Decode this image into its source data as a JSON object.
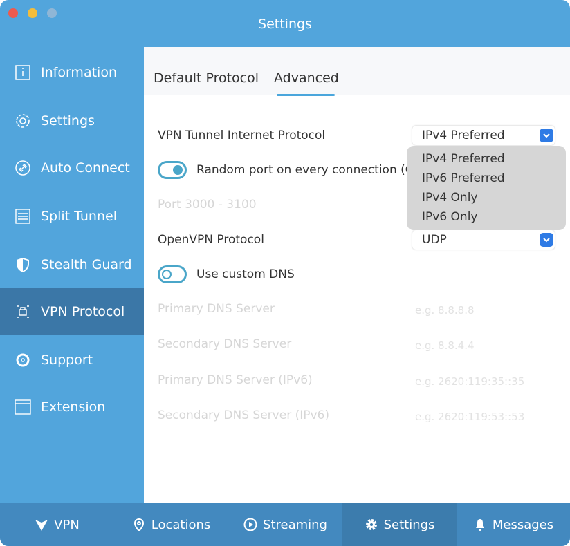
{
  "window": {
    "title": "Settings"
  },
  "sidebar": {
    "items": [
      {
        "label": "Information",
        "icon": "info-icon"
      },
      {
        "label": "Settings",
        "icon": "gear-icon"
      },
      {
        "label": "Auto Connect",
        "icon": "link-icon"
      },
      {
        "label": "Split Tunnel",
        "icon": "sliders-icon"
      },
      {
        "label": "Stealth Guard",
        "icon": "shield-icon"
      },
      {
        "label": "VPN Protocol",
        "icon": "network-icon",
        "selected": true
      },
      {
        "label": "Support",
        "icon": "lifebuoy-icon"
      },
      {
        "label": "Extension",
        "icon": "browser-window-icon"
      }
    ]
  },
  "tabs": [
    {
      "label": "Default Protocol"
    },
    {
      "label": "Advanced",
      "active": true
    }
  ],
  "form": {
    "tunnel_protocol": {
      "label": "VPN Tunnel Internet Protocol",
      "value": "IPv4 Preferred",
      "options": [
        "IPv4 Preferred",
        "IPv6 Preferred",
        "IPv4 Only",
        "IPv6 Only"
      ]
    },
    "random_port": {
      "label": "Random port on every connection (C",
      "enabled": true
    },
    "port_range": "Port 3000 - 3100",
    "openvpn_protocol": {
      "label": "OpenVPN Protocol",
      "value": "UDP"
    },
    "custom_dns": {
      "label": "Use custom DNS",
      "enabled": false
    },
    "dns": [
      {
        "label": "Primary DNS Server",
        "placeholder": "e.g. 8.8.8.8"
      },
      {
        "label": "Secondary DNS Server",
        "placeholder": "e.g. 8.8.4.4"
      },
      {
        "label": "Primary DNS Server (IPv6)",
        "placeholder": "e.g. 2620:119:35::35"
      },
      {
        "label": "Secondary DNS Server (IPv6)",
        "placeholder": "e.g. 2620:119:53::53"
      }
    ]
  },
  "bottom_nav": [
    {
      "label": "VPN",
      "icon": "vpn-logo-icon"
    },
    {
      "label": "Locations",
      "icon": "location-pin-icon"
    },
    {
      "label": "Streaming",
      "icon": "play-icon"
    },
    {
      "label": "Settings",
      "icon": "gear-icon",
      "selected": true
    },
    {
      "label": "Messages",
      "icon": "bell-icon"
    }
  ],
  "colors": {
    "sidebar": "#52a5dc",
    "selected": "#3b77a7",
    "bottom_bar": "#4389bf",
    "accent": "#2f7be5",
    "toggle": "#4aa6c9"
  }
}
